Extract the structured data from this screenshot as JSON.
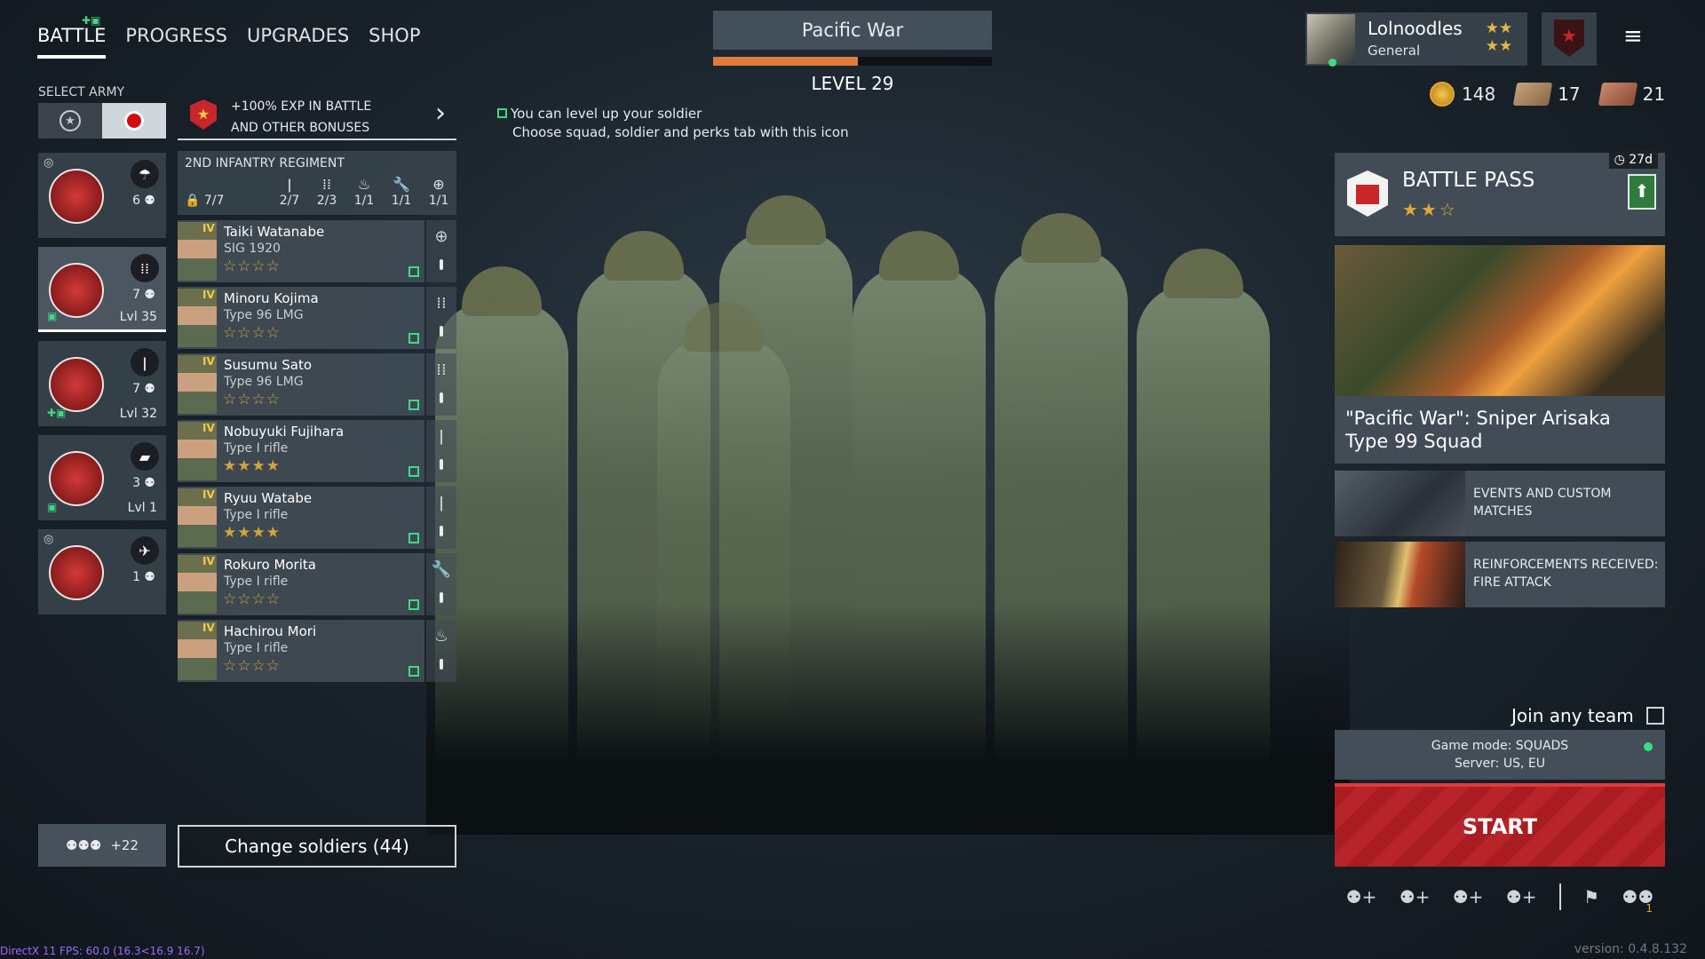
{
  "nav": {
    "tabs": [
      {
        "label": "BATTLE",
        "active": true
      },
      {
        "label": "PROGRESS",
        "active": false
      },
      {
        "label": "UPGRADES",
        "active": false
      },
      {
        "label": "SHOP",
        "active": false
      }
    ]
  },
  "army": {
    "label": "SELECT ARMY",
    "squads": [
      {
        "type_icon": "parachute-icon",
        "count": "6",
        "level": ""
      },
      {
        "type_icon": "ammo-icon",
        "count": "7",
        "level": "Lvl 35"
      },
      {
        "type_icon": "rifle-icon",
        "count": "7",
        "level": "Lvl 32"
      },
      {
        "type_icon": "tank-icon",
        "count": "3",
        "level": "Lvl 1"
      },
      {
        "type_icon": "plane-icon",
        "count": "1",
        "level": ""
      }
    ]
  },
  "bonus": {
    "line1": "+100% EXP IN BATTLE",
    "line2": "AND OTHER BONUSES"
  },
  "regiment": {
    "name": "2ND INFANTRY REGIMENT",
    "capacity": "7/7",
    "stats": [
      "2/7",
      "2/3",
      "1/1",
      "1/1",
      "1/1"
    ]
  },
  "soldiers": [
    {
      "name": "Taiki Watanabe",
      "weapon": "SIG 1920",
      "rank": "IV",
      "stars": "☆☆☆☆",
      "side_icon": "add-icon"
    },
    {
      "name": "Minoru Kojima",
      "weapon": "Type 96 LMG",
      "rank": "IV",
      "stars": "☆☆☆☆",
      "side_icon": "ammo-icon"
    },
    {
      "name": "Susumu Sato",
      "weapon": "Type 96 LMG",
      "rank": "IV",
      "stars": "☆☆☆☆",
      "side_icon": "ammo-icon"
    },
    {
      "name": "Nobuyuki Fujihara",
      "weapon": "Type I rifle",
      "rank": "IV",
      "stars": "★★★★",
      "side_icon": "rifle-icon"
    },
    {
      "name": "Ryuu Watabe",
      "weapon": "Type I rifle",
      "rank": "IV",
      "stars": "★★★★",
      "side_icon": "rifle-icon"
    },
    {
      "name": "Rokuro Morita",
      "weapon": "Type I rifle",
      "rank": "IV",
      "stars": "☆☆☆☆",
      "side_icon": "wrench-icon"
    },
    {
      "name": "Hachirou Mori",
      "weapon": "Type I rifle",
      "rank": "IV",
      "stars": "☆☆☆☆",
      "side_icon": "fire-icon"
    }
  ],
  "invite": {
    "count": "+22"
  },
  "change_soldiers": "Change soldiers (44)",
  "hint": {
    "line1": "You can level up your soldier",
    "line2": "Choose squad, soldier and perks tab with this icon"
  },
  "campaign": {
    "title": "Pacific War",
    "progress": 0.52,
    "level": "LEVEL 29"
  },
  "profile": {
    "name": "Lolnoodles",
    "rank": "General"
  },
  "currencies": {
    "gold": "148",
    "silver_tickets": "17",
    "gold_tickets": "21"
  },
  "battle_pass": {
    "title": "BATTLE PASS",
    "stars": "★★☆",
    "timer": "27d"
  },
  "feature": {
    "caption": "\"Pacific War\": Sniper Arisaka Type 99 Squad"
  },
  "tiles": [
    {
      "title": "EVENTS AND CUSTOM MATCHES"
    },
    {
      "title": "REINFORCEMENTS RECEIVED: FIRE ATTACK"
    }
  ],
  "join": {
    "label": "Join any team"
  },
  "mode": {
    "line1": "Game mode: SQUADS",
    "line2": "Server: US, EU"
  },
  "start": "START",
  "squad_count": "1",
  "debug": "DirectX 11 FPS: 60.0 (16.3<16.9 16.7)",
  "version": "version: 0.4.8.132",
  "colors": {
    "accent_red": "#b8242a",
    "campaign_progress": "#e27a3a",
    "online_green": "#3ddc84"
  }
}
